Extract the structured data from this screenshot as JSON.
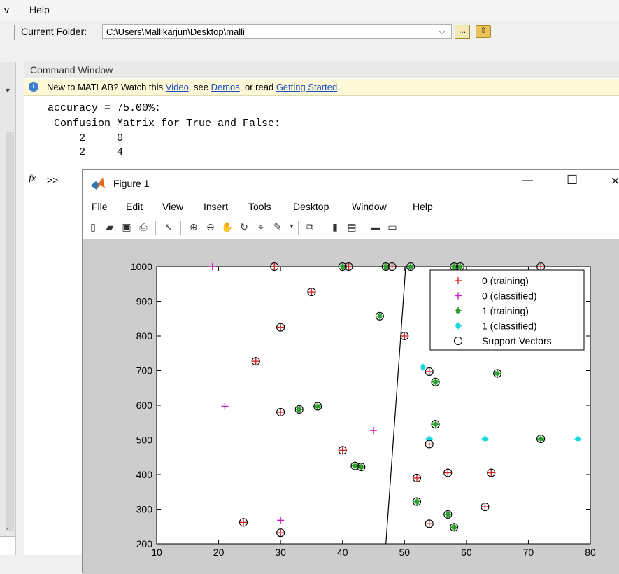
{
  "menu": {
    "v": "v",
    "help": "Help"
  },
  "folder": {
    "label": "Current Folder:",
    "path": "C:\\Users\\Mallikarjun\\Desktop\\malli",
    "dropdown_icon": "chevron-down-icon",
    "browse_label": "...",
    "up_icon": "folder-up-icon"
  },
  "command_window": {
    "title": "Command Window",
    "notice": {
      "prefix": "New to MATLAB? Watch this ",
      "video": "Video",
      "sep1": ", see ",
      "demos": "Demos",
      "sep2": ", or read ",
      "getting_started": "Getting Started",
      "end": "."
    },
    "lines": [
      "accuracy = 75.00%:",
      " Confusion Matrix for True and False:",
      "     2     0",
      "     2     4"
    ],
    "fx": "fx",
    "prompt": ">>"
  },
  "figure": {
    "title": "Figure 1",
    "minimize": "—",
    "maximize": "☐",
    "close": "✕",
    "menu": [
      "File",
      "Edit",
      "View",
      "Insert",
      "Tools",
      "Desktop",
      "Window",
      "Help"
    ]
  },
  "chart_data": {
    "type": "scatter",
    "xlim": [
      10,
      80
    ],
    "ylim": [
      200,
      1000
    ],
    "xticks": [
      10,
      20,
      30,
      40,
      50,
      60,
      70,
      80
    ],
    "yticks": [
      200,
      300,
      400,
      500,
      600,
      700,
      800,
      900,
      1000
    ],
    "grid": false,
    "legend_position": "top-right",
    "colors": {
      "class0_training": "#d62728",
      "class0_classified": "#c020c0",
      "class1_training": "#2ca02c",
      "class1_classified": "#17d8d8",
      "support": "#000000"
    },
    "series": [
      {
        "name": "0 (training)",
        "marker": "+",
        "color": "#d62728",
        "points": [
          [
            29,
            1000
          ],
          [
            41,
            1000
          ],
          [
            48,
            1000
          ],
          [
            72,
            1000
          ],
          [
            35,
            927
          ],
          [
            30,
            825
          ],
          [
            50,
            800
          ],
          [
            26,
            727
          ],
          [
            54,
            697
          ],
          [
            30,
            580
          ],
          [
            40,
            470
          ],
          [
            54,
            488
          ],
          [
            52,
            390
          ],
          [
            57,
            405
          ],
          [
            64,
            405
          ],
          [
            63,
            307
          ],
          [
            24,
            262
          ],
          [
            54,
            258
          ],
          [
            30,
            232
          ]
        ]
      },
      {
        "name": "0 (classified)",
        "marker": "+",
        "color": "#c020c0",
        "points": [
          [
            19,
            1000
          ],
          [
            21,
            597
          ],
          [
            45,
            527
          ],
          [
            30,
            268
          ]
        ]
      },
      {
        "name": "1 (training)",
        "marker": "*",
        "color": "#2ca02c",
        "points": [
          [
            40,
            1000
          ],
          [
            47,
            1000
          ],
          [
            51,
            1000
          ],
          [
            58,
            1000
          ],
          [
            59,
            1000
          ],
          [
            46,
            857
          ],
          [
            55,
            667
          ],
          [
            65,
            692
          ],
          [
            33,
            588
          ],
          [
            36,
            597
          ],
          [
            55,
            545
          ],
          [
            72,
            503
          ],
          [
            42,
            425
          ],
          [
            43,
            422
          ],
          [
            52,
            322
          ],
          [
            57,
            285
          ],
          [
            58,
            248
          ]
        ]
      },
      {
        "name": "1 (classified)",
        "marker": "*",
        "color": "#17d8d8",
        "points": [
          [
            53,
            710
          ],
          [
            54,
            503
          ],
          [
            63,
            503
          ],
          [
            78,
            503
          ]
        ]
      },
      {
        "name": "Support Vectors",
        "marker": "o",
        "color": "#000000",
        "points": [
          [
            29,
            1000
          ],
          [
            41,
            1000
          ],
          [
            48,
            1000
          ],
          [
            72,
            1000
          ],
          [
            35,
            927
          ],
          [
            30,
            825
          ],
          [
            50,
            800
          ],
          [
            26,
            727
          ],
          [
            54,
            697
          ],
          [
            30,
            580
          ],
          [
            40,
            470
          ],
          [
            54,
            488
          ],
          [
            52,
            390
          ],
          [
            57,
            405
          ],
          [
            64,
            405
          ],
          [
            63,
            307
          ],
          [
            24,
            262
          ],
          [
            54,
            258
          ],
          [
            30,
            232
          ],
          [
            40,
            1000
          ],
          [
            47,
            1000
          ],
          [
            51,
            1000
          ],
          [
            58,
            1000
          ],
          [
            59,
            1000
          ],
          [
            46,
            857
          ],
          [
            55,
            667
          ],
          [
            65,
            692
          ],
          [
            33,
            588
          ],
          [
            36,
            597
          ],
          [
            55,
            545
          ],
          [
            72,
            503
          ],
          [
            42,
            425
          ],
          [
            43,
            422
          ],
          [
            52,
            322
          ],
          [
            57,
            285
          ],
          [
            58,
            248
          ]
        ]
      }
    ],
    "boundary": {
      "x": [
        47,
        50.2
      ],
      "y": [
        200,
        1000
      ]
    }
  }
}
